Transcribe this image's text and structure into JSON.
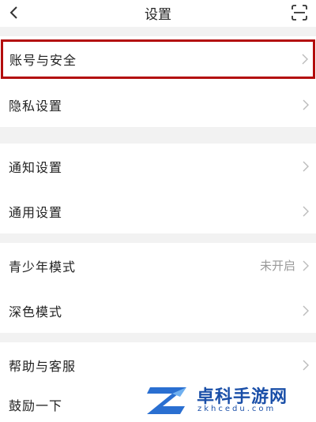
{
  "header": {
    "title": "设置"
  },
  "groups": [
    {
      "items": [
        {
          "label": "账号与安全"
        },
        {
          "label": "隐私设置"
        }
      ]
    },
    {
      "items": [
        {
          "label": "通知设置"
        },
        {
          "label": "通用设置"
        }
      ]
    },
    {
      "items": [
        {
          "label": "青少年模式",
          "value": "未开启"
        },
        {
          "label": "深色模式"
        }
      ]
    },
    {
      "items": [
        {
          "label": "帮助与客服"
        },
        {
          "label": "鼓励一下"
        }
      ]
    }
  ],
  "watermark": {
    "brand": "卓科手游网",
    "url": "zkhcedu.com"
  },
  "colors": {
    "highlight": "#b30d0d",
    "watermark": "#1a4fa8"
  },
  "icons": [
    "back-arrow-icon",
    "scan-icon",
    "chevron-right-icon"
  ]
}
